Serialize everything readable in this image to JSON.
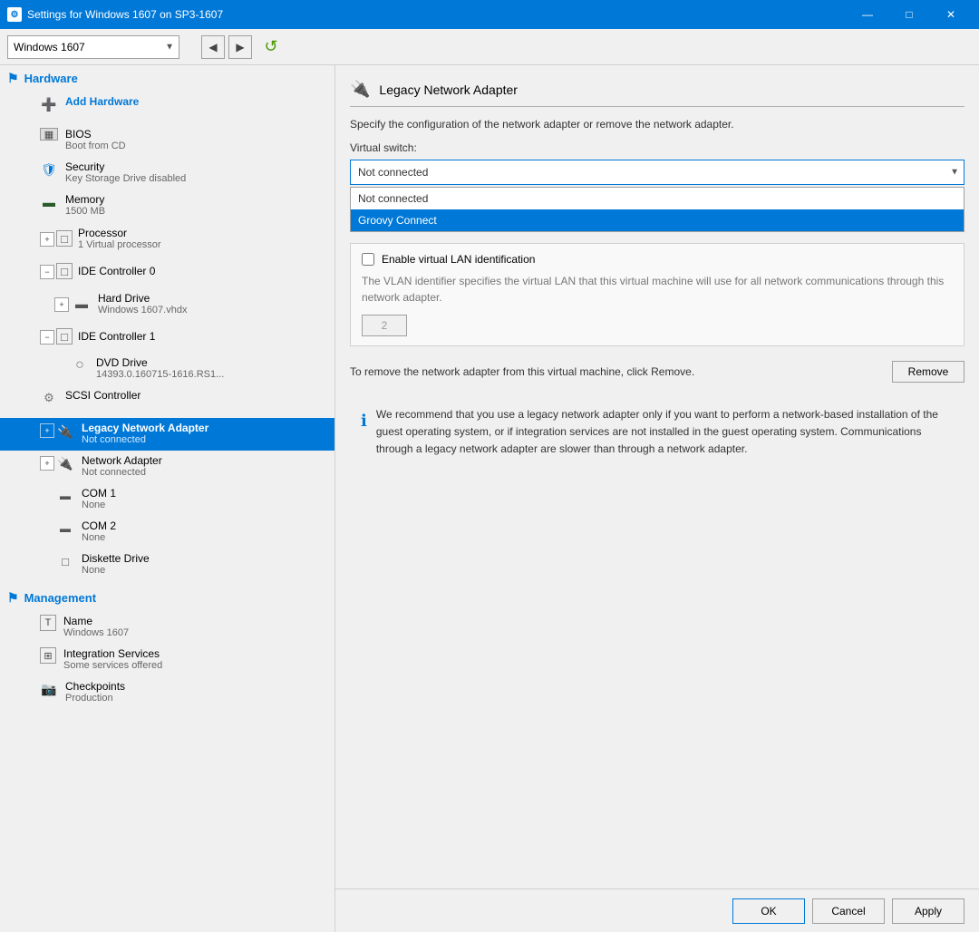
{
  "window": {
    "title": "Settings for Windows 1607 on SP3-1607",
    "icon": "⚙"
  },
  "titlebar": {
    "minimize": "—",
    "maximize": "□",
    "close": "✕"
  },
  "toolbar": {
    "vm_name": "Windows 1607",
    "back_label": "◀",
    "forward_label": "▶",
    "refresh_label": "↺"
  },
  "sidebar": {
    "hardware_label": "Hardware",
    "management_label": "Management",
    "items": [
      {
        "id": "add-hardware",
        "name": "Add Hardware",
        "sub": "",
        "indent": 1,
        "icon": "➕",
        "expand": null
      },
      {
        "id": "bios",
        "name": "BIOS",
        "sub": "Boot from CD",
        "indent": 1,
        "icon": "▦",
        "expand": null
      },
      {
        "id": "security",
        "name": "Security",
        "sub": "Key Storage Drive disabled",
        "indent": 1,
        "icon": "🛡",
        "expand": null
      },
      {
        "id": "memory",
        "name": "Memory",
        "sub": "1500 MB",
        "indent": 1,
        "icon": "▬",
        "expand": null
      },
      {
        "id": "processor",
        "name": "Processor",
        "sub": "1 Virtual processor",
        "indent": 1,
        "icon": "□",
        "expand": "+"
      },
      {
        "id": "ide0",
        "name": "IDE Controller 0",
        "sub": "",
        "indent": 1,
        "icon": "□",
        "expand": "−"
      },
      {
        "id": "harddrive",
        "name": "Hard Drive",
        "sub": "Windows 1607.vhdx",
        "indent": 2,
        "icon": "▬",
        "expand": "+"
      },
      {
        "id": "ide1",
        "name": "IDE Controller 1",
        "sub": "",
        "indent": 1,
        "icon": "□",
        "expand": "−"
      },
      {
        "id": "dvddrive",
        "name": "DVD Drive",
        "sub": "14393.0.160715-1616.RS1...",
        "indent": 2,
        "icon": "○",
        "expand": null
      },
      {
        "id": "scsi",
        "name": "SCSI Controller",
        "sub": "",
        "indent": 1,
        "icon": "⚙",
        "expand": null
      },
      {
        "id": "legacy-nic",
        "name": "Legacy Network Adapter",
        "sub": "Not connected",
        "indent": 1,
        "icon": "🔌",
        "expand": "+",
        "active": true
      },
      {
        "id": "network-adapter",
        "name": "Network Adapter",
        "sub": "Not connected",
        "indent": 1,
        "icon": "🔌",
        "expand": "+"
      },
      {
        "id": "com1",
        "name": "COM 1",
        "sub": "None",
        "indent": 1,
        "icon": "▬",
        "expand": null
      },
      {
        "id": "com2",
        "name": "COM 2",
        "sub": "None",
        "indent": 1,
        "icon": "▬",
        "expand": null
      },
      {
        "id": "diskette",
        "name": "Diskette Drive",
        "sub": "None",
        "indent": 1,
        "icon": "□",
        "expand": null
      }
    ],
    "management_items": [
      {
        "id": "name",
        "name": "Name",
        "sub": "Windows 1607",
        "icon": "T"
      },
      {
        "id": "integration",
        "name": "Integration Services",
        "sub": "Some services offered",
        "icon": "⊞"
      },
      {
        "id": "checkpoints",
        "name": "Checkpoints",
        "sub": "Production",
        "icon": "📷"
      }
    ]
  },
  "panel": {
    "header_icon": "🔌",
    "header_title": "Legacy Network Adapter",
    "description": "Specify the configuration of the network adapter or remove the network adapter.",
    "virtual_switch_label": "Virtual switch:",
    "selected_switch": "Not connected",
    "dropdown_options": [
      {
        "id": "not-connected",
        "label": "Not connected",
        "highlighted": false
      },
      {
        "id": "groovy-connect",
        "label": "Groovy Connect",
        "highlighted": true
      }
    ],
    "enable_vlan_label": "Enable virtual LAN identification",
    "vlan_description": "The VLAN identifier specifies the virtual LAN that this virtual machine will use for all network communications through this network adapter.",
    "vlan_value": "2",
    "remove_text": "To remove the network adapter from this virtual machine, click Remove.",
    "remove_btn_label": "Remove",
    "info_text": "We recommend that you use a legacy network adapter only if you want to perform a network-based installation of the guest operating system, or if integration services are not installed in the guest operating system. Communications through a legacy network adapter are slower than through a network adapter.",
    "ok_label": "OK",
    "cancel_label": "Cancel",
    "apply_label": "Apply"
  }
}
